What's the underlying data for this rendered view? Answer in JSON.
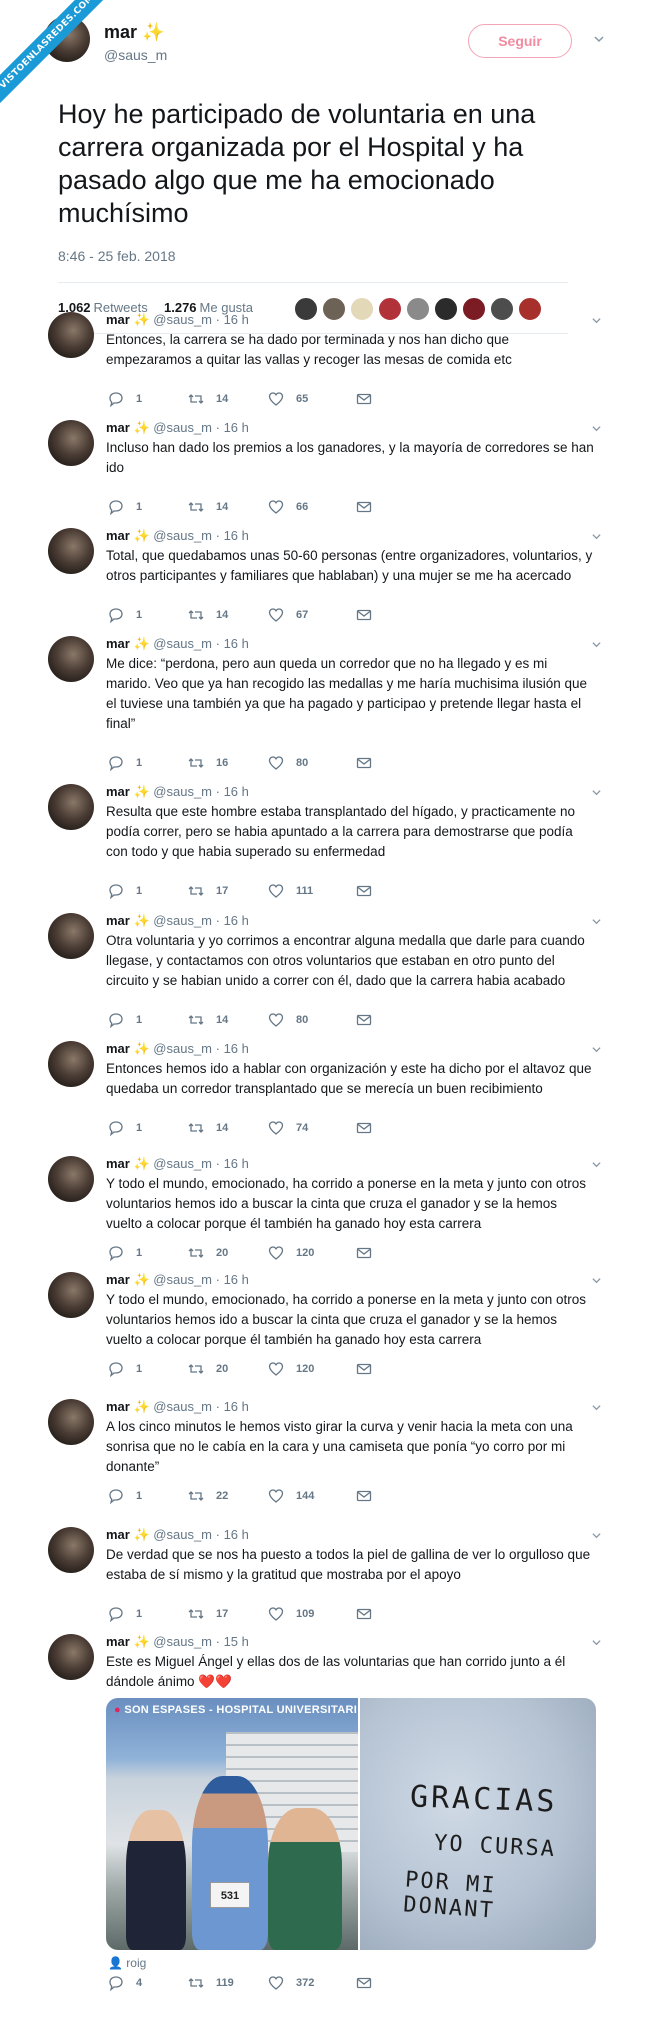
{
  "watermark": "VISTOENLASREDES.COM",
  "colors": {
    "accent": "#1a9ad6",
    "follow": "#f28ba0",
    "muted": "#657786",
    "heart": "#e0245e"
  },
  "main_tweet": {
    "name": "mar",
    "sparkle": "✨",
    "handle": "@saus_m",
    "follow_label": "Seguir",
    "text": "Hoy he participado de voluntaria en una carrera organizada por el Hospital y ha pasado algo que me ha emocionado muchísimo",
    "datetime": "8:46 - 25 feb. 2018",
    "retweets_count": "1.062",
    "retweets_label": "Retweets",
    "likes_count": "1.276",
    "likes_label": "Me gusta"
  },
  "replies": [
    {
      "name": "mar",
      "sparkle": "✨",
      "handle": "@saus_m",
      "time": "16 h",
      "text": "Entonces, la carrera se ha dado por terminada y nos han dicho que empezaramos a quitar las vallas y recoger las mesas de comida etc",
      "replies": "1",
      "retweets": "14",
      "likes": "65"
    },
    {
      "name": "mar",
      "sparkle": "✨",
      "handle": "@saus_m",
      "time": "16 h",
      "text": "Incluso han dado los premios a los ganadores, y la mayoría de corredores se han ido",
      "replies": "1",
      "retweets": "14",
      "likes": "66"
    },
    {
      "name": "mar",
      "sparkle": "✨",
      "handle": "@saus_m",
      "time": "16 h",
      "text": "Total, que quedabamos unas 50-60 personas (entre organizadores, voluntarios, y otros participantes y familiares que hablaban) y una mujer se me ha acercado",
      "replies": "1",
      "retweets": "14",
      "likes": "67"
    },
    {
      "name": "mar",
      "sparkle": "✨",
      "handle": "@saus_m",
      "time": "16 h",
      "text": "Me dice: “perdona, pero aun queda un corredor que no ha llegado y es mi marido. Veo que ya han recogido las medallas y me haría muchisima ilusión que el tuviese una también ya que ha pagado y participao y pretende llegar hasta el final”",
      "replies": "1",
      "retweets": "16",
      "likes": "80"
    },
    {
      "name": "mar",
      "sparkle": "✨",
      "handle": "@saus_m",
      "time": "16 h",
      "text": "Resulta que este hombre estaba transplantado del hígado, y practicamente no podía correr, pero se habia apuntado a la carrera para demostrarse que podía con todo y que habia superado su enfermedad",
      "replies": "1",
      "retweets": "17",
      "likes": "111"
    },
    {
      "name": "mar",
      "sparkle": "✨",
      "handle": "@saus_m",
      "time": "16 h",
      "text": "Otra voluntaria y yo corrimos a encontrar alguna medalla que darle para cuando llegase, y contactamos con otros voluntarios que estaban en otro punto del circuito y se habian unido a correr con él, dado que la carrera habia acabado",
      "replies": "1",
      "retweets": "14",
      "likes": "80"
    },
    {
      "name": "mar",
      "sparkle": "✨",
      "handle": "@saus_m",
      "time": "16 h",
      "text": "Entonces hemos ido a hablar con organización y este ha dicho por el altavoz que quedaba un corredor transplantado que se merecía un buen recibimiento",
      "replies": "1",
      "retweets": "14",
      "likes": "74"
    },
    {
      "name": "mar",
      "sparkle": "✨",
      "handle": "@saus_m",
      "time": "16 h",
      "text": "Y todo el mundo, emocionado, ha corrido a ponerse en la meta y junto con otros voluntarios hemos ido a buscar la cinta que cruza el ganador y se la hemos vuelto a colocar porque él también ha ganado hoy esta carrera",
      "replies": "1",
      "retweets": "20",
      "likes": "120"
    },
    {
      "name": "mar",
      "sparkle": "✨",
      "handle": "@saus_m",
      "time": "16 h",
      "text": "Y todo el mundo, emocionado, ha corrido a ponerse en la meta y junto con otros voluntarios hemos ido a buscar la cinta que cruza el ganador y se la hemos vuelto a colocar porque él también ha ganado hoy esta carrera",
      "replies": "1",
      "retweets": "20",
      "likes": "120"
    },
    {
      "name": "mar",
      "sparkle": "✨",
      "handle": "@saus_m",
      "time": "16 h",
      "text": "A los cinco minutos le hemos visto girar la curva y venir hacia la meta con una sonrisa que no le cabía en la cara y una camiseta que ponía “yo corro por mi donante”",
      "replies": "1",
      "retweets": "22",
      "likes": "144"
    },
    {
      "name": "mar",
      "sparkle": "✨",
      "handle": "@saus_m",
      "time": "16 h",
      "text": "De verdad que se nos ha puesto a todos la piel de gallina de ver lo orgulloso que estaba de sí mismo y la gratitud que mostraba por el apoyo",
      "replies": "1",
      "retweets": "17",
      "likes": "109"
    },
    {
      "name": "mar",
      "sparkle": "✨",
      "handle": "@saus_m",
      "time": "15 h",
      "text": "Este es Miguel Ángel y ellas dos de las voluntarias que han corrido junto a él dándole ánimo ❤️❤️",
      "replies": "4",
      "retweets": "119",
      "likes": "372"
    }
  ],
  "media": {
    "location_label": "SON ESPASES - HOSPITAL UNIVERSITARI",
    "bib_number": "531",
    "shirt_text_1": "GRACIAS",
    "shirt_text_2": "YO CURSA",
    "shirt_text_3": "POR MI DONANT",
    "tagged_user": "roig"
  }
}
